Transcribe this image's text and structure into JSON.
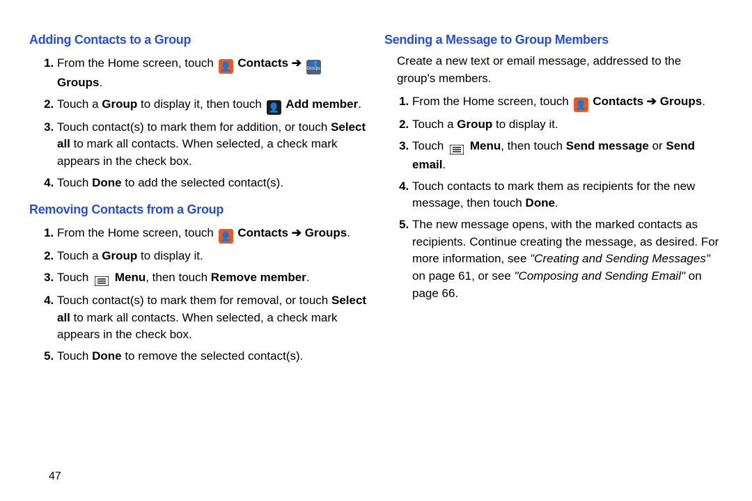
{
  "sections": {
    "adding": {
      "heading": "Adding Contacts to a Group",
      "s1a": "From the Home screen, touch ",
      "s1b": " Contacts",
      "s1c": " Groups",
      "s1d": ".",
      "s2a": "Touch a ",
      "s2b": "Group",
      "s2c": " to display it, then touch ",
      "s2d": " Add member",
      "s2e": ".",
      "s3a": "Touch contact(s) to mark them for addition, or touch ",
      "s3b": "Select all",
      "s3c": " to mark all contacts. When selected, a check mark appears in the check box.",
      "s4a": "Touch ",
      "s4b": "Done",
      "s4c": " to add the selected contact(s)."
    },
    "removing": {
      "heading": "Removing Contacts from a Group",
      "s1a": "From the Home screen, touch ",
      "s1b": " Contacts ➔ Groups",
      "s1c": ".",
      "s2a": "Touch a ",
      "s2b": "Group",
      "s2c": " to display it.",
      "s3a": "Touch ",
      "s3b": " Menu",
      "s3c": ", then touch ",
      "s3d": "Remove member",
      "s3e": ".",
      "s4a": "Touch contact(s) to mark them for removal, or touch ",
      "s4b": "Select all",
      "s4c": " to mark all contacts. When selected, a check mark appears in the check box.",
      "s5a": "Touch ",
      "s5b": "Done",
      "s5c": " to remove the selected contact(s)."
    },
    "sending": {
      "heading": "Sending a Message to Group Members",
      "lead": "Create a new text or email message, addressed to the group's members.",
      "s1a": "From the Home screen, touch ",
      "s1b": " Contacts ➔ Groups",
      "s1c": ".",
      "s2a": "Touch a ",
      "s2b": "Group",
      "s2c": " to display it.",
      "s3a": "Touch ",
      "s3b": " Menu",
      "s3c": ", then touch ",
      "s3d": "Send message",
      "s3e": " or ",
      "s3f": "Send email",
      "s3g": ".",
      "s4a": "Touch contacts to mark them as recipients for the new message, then touch ",
      "s4b": "Done",
      "s4c": ".",
      "s5a": "The new message opens, with the marked contacts as recipients. Continue creating the message, as desired. For more information, see ",
      "s5b": "\"Creating and Sending Messages\"",
      "s5c": " on page 61, or see ",
      "s5d": "\"Composing and Sending Email\"",
      "s5e": " on page 66."
    }
  },
  "page_number": "47"
}
